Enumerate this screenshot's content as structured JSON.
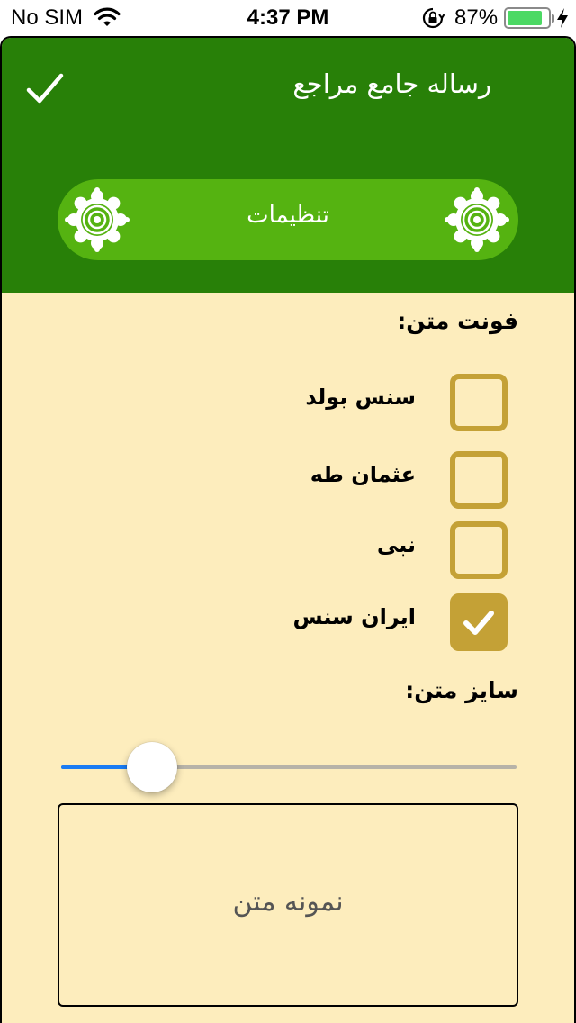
{
  "status_bar": {
    "carrier": "No SIM",
    "time": "4:37 PM",
    "battery_percent": "87%",
    "battery_level": 0.87,
    "icons": [
      "wifi-icon",
      "orientation-lock-icon",
      "battery-icon",
      "charging-bolt-icon"
    ]
  },
  "header": {
    "title": "رساله جامع مراجع",
    "done_icon": "checkmark-icon",
    "banner_label": "تنظیمات",
    "ornament_icon": "ornament-icon",
    "background_color": "#288008",
    "banner_color": "#55b311"
  },
  "font_section": {
    "label": "فونت متن:",
    "options": [
      {
        "label": "سنس بولد",
        "checked": false
      },
      {
        "label": "عثمان طه",
        "checked": false
      },
      {
        "label": "نبی",
        "checked": false
      },
      {
        "label": "ایران سنس",
        "checked": true
      }
    ],
    "checkbox_color": "#c4a136"
  },
  "size_section": {
    "label": "سایز متن:",
    "slider_value": 0.2,
    "slider_fill_color": "#1b7cf3"
  },
  "preview": {
    "sample_text": "نمونه متن"
  },
  "page_background": "#fdedbd"
}
